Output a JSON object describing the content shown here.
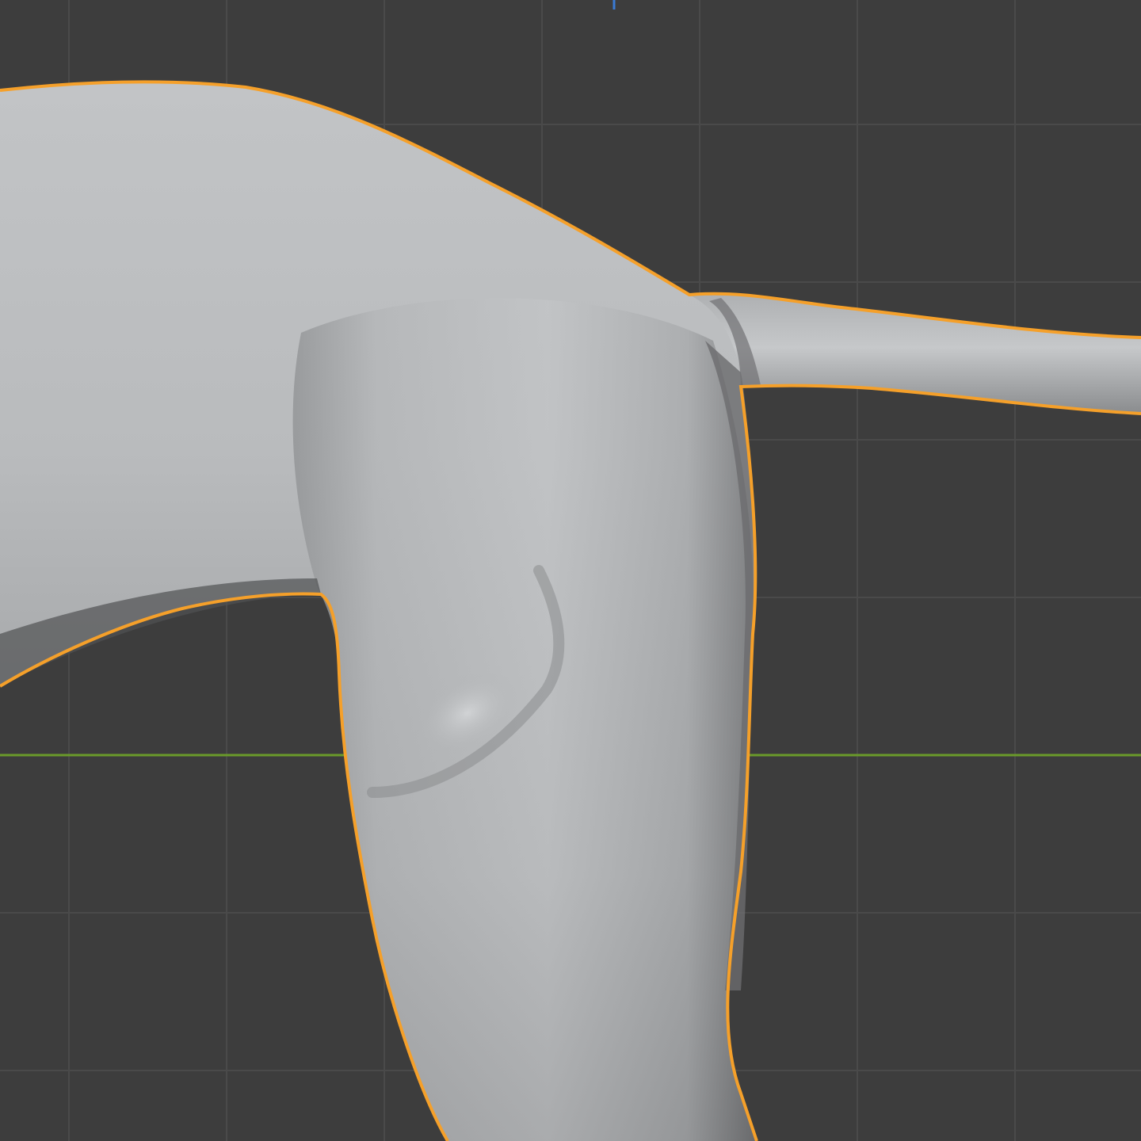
{
  "viewport": {
    "mode": "3d-viewport",
    "background_color": "#3d3d3d",
    "grid_color": "#4a4a4a",
    "x_axis_color": "#6a9a2a",
    "z_axis_marker_color": "#3a7bd5"
  },
  "object": {
    "selected": true,
    "selection_outline_color": "#f5a02a",
    "material_color": "#b8babc",
    "icon": "sculpt-mesh-icon"
  }
}
